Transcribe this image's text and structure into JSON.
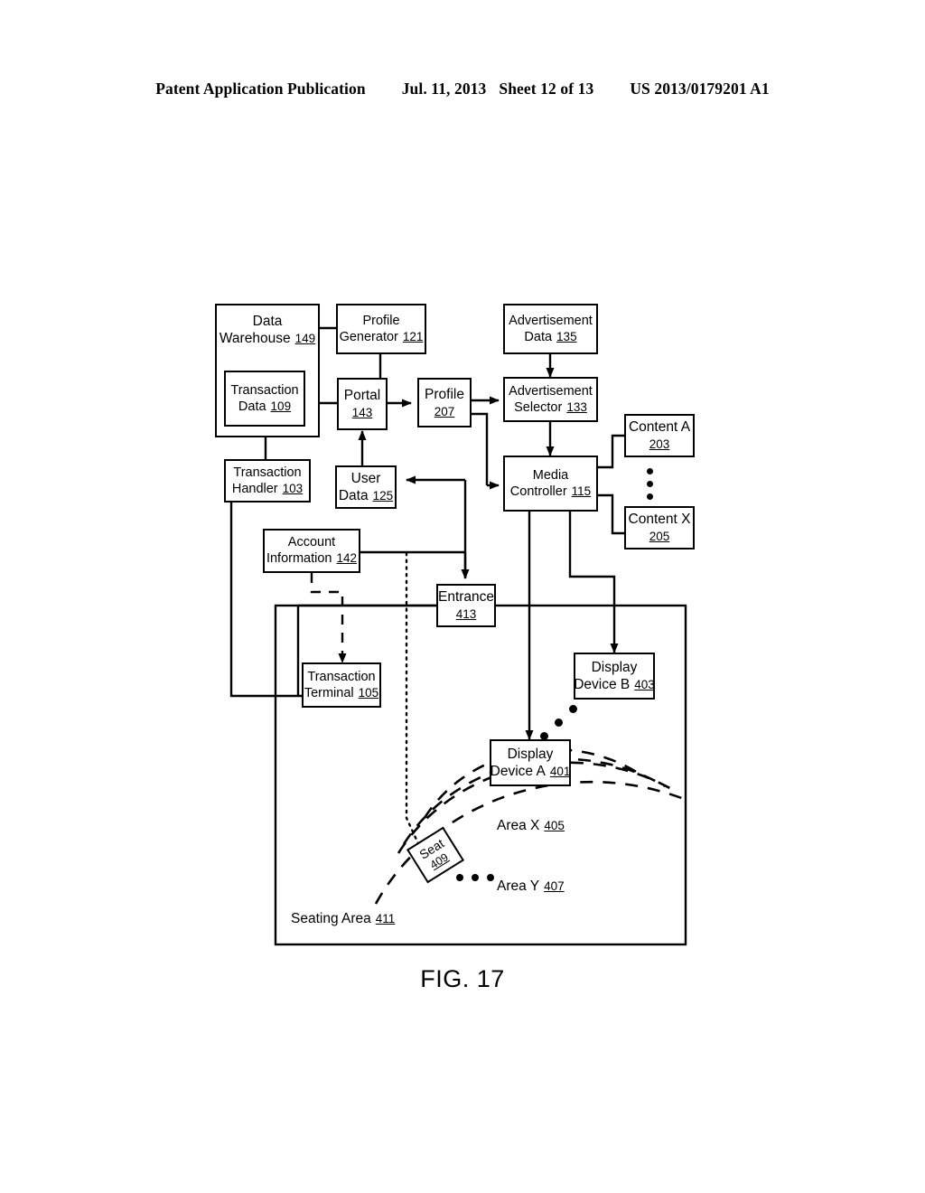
{
  "header": {
    "publication": "Patent Application Publication",
    "date": "Jul. 11, 2013",
    "sheet": "Sheet 12 of 13",
    "patent_number": "US 2013/0179201 A1"
  },
  "figure": {
    "caption": "FIG. 17",
    "nodes": {
      "data_warehouse": {
        "line1": "Data",
        "line2": "Warehouse",
        "ref": "149"
      },
      "transaction_data": {
        "line1": "Transaction",
        "line2": "Data",
        "ref": "109"
      },
      "profile_generator": {
        "line1": "Profile",
        "line2": "Generator",
        "ref": "121"
      },
      "advertisement_data": {
        "line1": "Advertisement",
        "line2": "Data",
        "ref": "135"
      },
      "portal": {
        "line1": "Portal",
        "line2": "",
        "ref": "143"
      },
      "profile": {
        "line1": "Profile",
        "line2": "",
        "ref": "207"
      },
      "advertisement_selector": {
        "line1": "Advertisement",
        "line2": "Selector",
        "ref": "133"
      },
      "transaction_handler": {
        "line1": "Transaction",
        "line2": "Handler",
        "ref": "103"
      },
      "user_data": {
        "line1": "User",
        "line2": "Data",
        "ref": "125"
      },
      "media_controller": {
        "line1": "Media",
        "line2": "Controller",
        "ref": "115"
      },
      "content_a": {
        "line1": "Content A",
        "line2": "",
        "ref": "203"
      },
      "content_x": {
        "line1": "Content X",
        "line2": "",
        "ref": "205"
      },
      "account_information": {
        "line1": "Account",
        "line2": "Information",
        "ref": "142"
      },
      "entrance": {
        "line1": "Entrance",
        "line2": "",
        "ref": "413"
      },
      "display_device_b": {
        "line1": "Display",
        "line2": "Device B",
        "ref": "403"
      },
      "transaction_terminal": {
        "line1": "Transaction",
        "line2": "Terminal",
        "ref": "105"
      },
      "display_device_a": {
        "line1": "Display",
        "line2": "Device A",
        "ref": "401"
      },
      "seat": {
        "line1": "Seat",
        "line2": "",
        "ref": "409"
      }
    },
    "labels": {
      "area_x": {
        "text": "Area X",
        "ref": "405"
      },
      "area_y": {
        "text": "Area Y",
        "ref": "407"
      },
      "seating_area": {
        "text": "Seating Area",
        "ref": "411"
      }
    }
  }
}
